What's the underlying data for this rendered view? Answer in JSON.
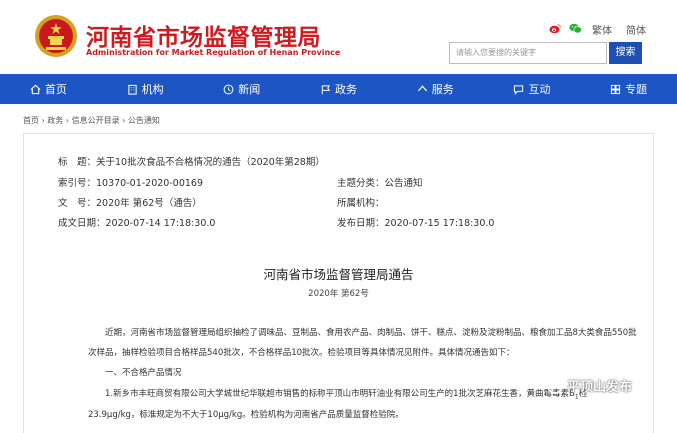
{
  "header": {
    "site_name_cn": "河南省市场监督管理局",
    "site_name_en": "Administration for Market Regulation of Henan Province",
    "lang_traditional": "繁体",
    "lang_simplified": "简体",
    "search_placeholder": "请输入您要搜的关键字",
    "search_button": "搜索",
    "brand_color": "#d01a1f"
  },
  "nav": {
    "items": [
      {
        "label": "首页",
        "icon": "home-icon"
      },
      {
        "label": "机构",
        "icon": "building-icon"
      },
      {
        "label": "新闻",
        "icon": "news-icon"
      },
      {
        "label": "政务",
        "icon": "flag-icon"
      },
      {
        "label": "服务",
        "icon": "service-icon"
      },
      {
        "label": "互动",
        "icon": "interaction-icon"
      },
      {
        "label": "专题",
        "icon": "topic-icon"
      }
    ],
    "color": "#1e55c4"
  },
  "breadcrumb": "首页 › 政务 › 信息公开目录 › 公告通知",
  "meta": {
    "title": "标　题：关于10批次食品不合格情况的通告（2020年第28期）",
    "index_no": "索引号：10370-01-2020-00169",
    "category": "主题分类：公告通知",
    "doc_no": "文　号：2020年 第62号（通告）",
    "org": "所属机构：",
    "created": "成文日期：2020-07-14 17:18:30.0",
    "published": "发布日期：2020-07-15 17:18:30.0"
  },
  "doc": {
    "heading": "河南省市场监督管理局通告",
    "number": "2020年 第62号",
    "para1": "近期，河南省市场监督管理局组织抽检了调味品、豆制品、食用农产品、肉制品、饼干、糕点、淀粉及淀粉制品、粮食加工品8大类食品550批",
    "para1b": "次样品，抽样检验项目合格样品540批次，不合格样品10批次。检验项目等具体情况见附件。具体情况通告如下：",
    "section1": "一、不合格产品情况",
    "item1_a": "1.新乡市丰旺商贸有限公司大学城世纪华联超市销售的标称平顶山市明轩油业有限公司生产的1批次芝麻花生香，黄曲霉毒素B",
    "item1_sub": "1",
    "item1_b": "检",
    "item1_c": "23.9μg/kg，标准规定为不大于10μg/kg。检验机构为河南省产品质量监督检验院。"
  },
  "watermark": "平顶山发布"
}
